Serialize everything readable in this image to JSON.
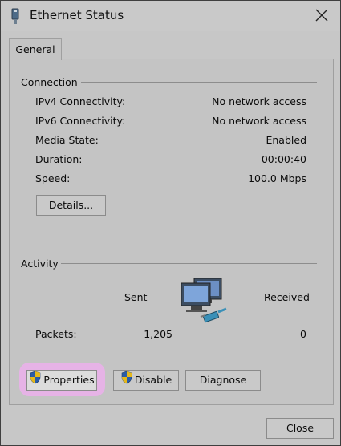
{
  "window": {
    "title": "Ethernet Status"
  },
  "tabs": [
    {
      "label": "General"
    }
  ],
  "connection": {
    "header": "Connection",
    "rows": [
      {
        "label": "IPv4 Connectivity:",
        "value": "No network access"
      },
      {
        "label": "IPv6 Connectivity:",
        "value": "No network access"
      },
      {
        "label": "Media State:",
        "value": "Enabled"
      },
      {
        "label": "Duration:",
        "value": "00:00:40"
      },
      {
        "label": "Speed:",
        "value": "100.0 Mbps"
      }
    ],
    "details_label": "Details..."
  },
  "activity": {
    "header": "Activity",
    "sent_label": "Sent",
    "received_label": "Received",
    "packets_label": "Packets:",
    "packets_sent": "1,205",
    "packets_received": "0"
  },
  "buttons": {
    "properties": "Properties",
    "disable": "Disable",
    "diagnose": "Diagnose",
    "close": "Close"
  },
  "icons": {
    "title": "ethernet-adapter-icon",
    "close": "close-icon",
    "network": "network-computers-icon",
    "shield": "uac-shield-icon"
  },
  "colors": {
    "highlight": "#e6b3e6",
    "shield_blue": "#2a5ca8",
    "shield_yellow": "#e5b81a"
  }
}
